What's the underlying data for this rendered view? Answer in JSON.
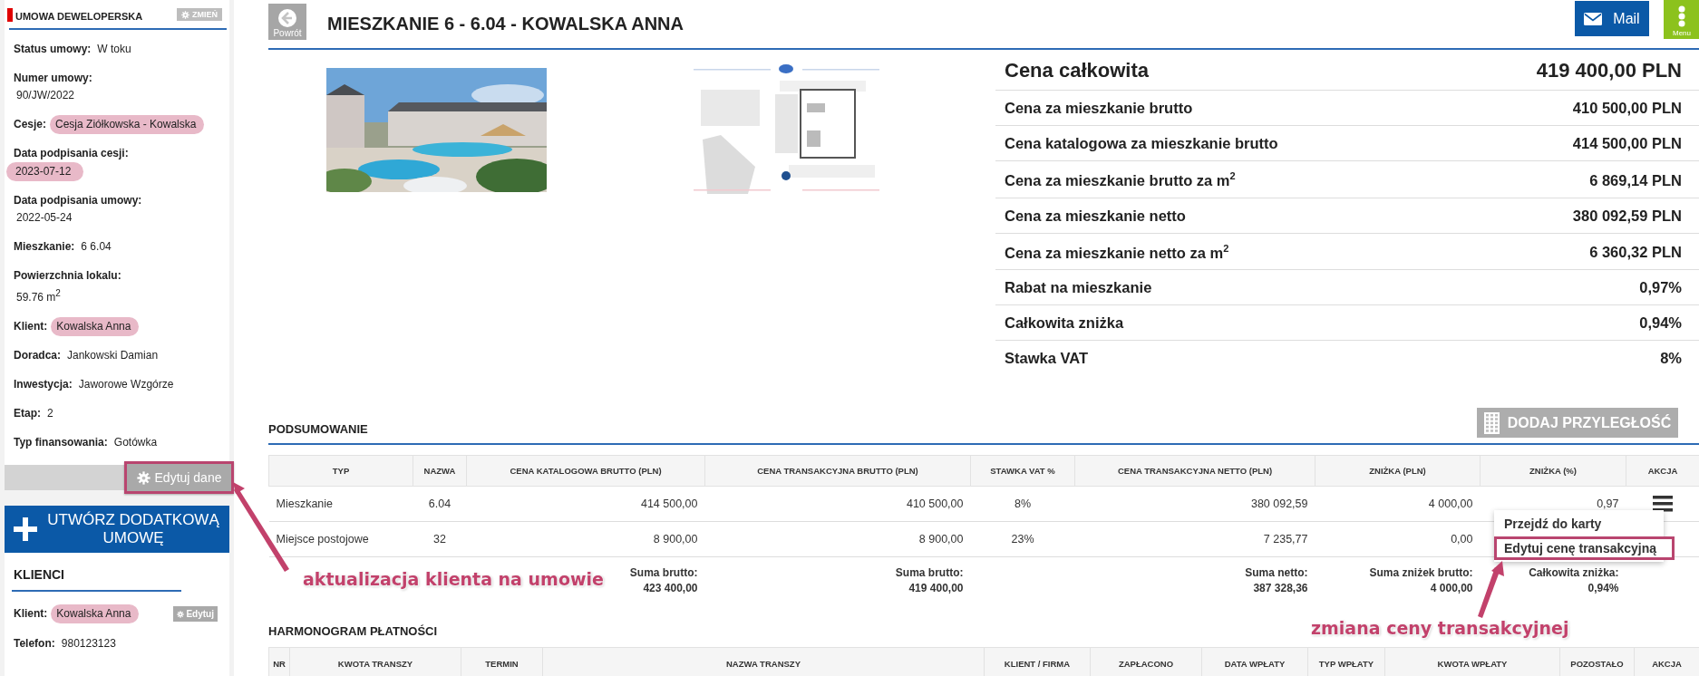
{
  "sidebar": {
    "contract_card": {
      "title": "UMOWA DEWELOPERSKA",
      "change_button": "ZMIEŃ",
      "fields": [
        {
          "label": "Status umowy:",
          "value": "W toku",
          "kind": "inline",
          "highlighted": false
        },
        {
          "label": "Numer umowy:",
          "value": "90/JW/2022",
          "kind": "block",
          "highlighted": false
        },
        {
          "label": "Cesje:",
          "value": "Cesja Ziółkowska - Kowalska",
          "kind": "inline",
          "highlighted": true
        },
        {
          "label": "Data podpisania cesji:",
          "value": "2023-07-12",
          "kind": "block",
          "highlighted": true
        },
        {
          "label": "Data podpisania umowy:",
          "value": "2022-05-24",
          "kind": "block",
          "highlighted": false
        },
        {
          "label": "Mieszkanie:",
          "value": "6 6.04",
          "kind": "inline",
          "highlighted": false
        },
        {
          "label": "Powierzchnia lokalu:",
          "value": "59.76 m$^{2}$",
          "kind": "block",
          "highlighted": false
        },
        {
          "label": "Klient:",
          "value": "Kowalska Anna",
          "kind": "inline",
          "highlighted": true
        },
        {
          "label": "Doradca:",
          "value": "Jankowski Damian",
          "kind": "inline",
          "highlighted": false
        },
        {
          "label": "Inwestycja:",
          "value": "Jaworowe Wzgórze",
          "kind": "inline",
          "highlighted": false
        },
        {
          "label": "Etap:",
          "value": "2",
          "kind": "inline",
          "highlighted": false
        },
        {
          "label": "Typ finansowania:",
          "value": "Gotówka",
          "kind": "inline",
          "highlighted": false
        }
      ],
      "edit_button": {
        "label": "Edytuj dane",
        "highlighted": true
      }
    },
    "create_button": "UTWÓRZ DODATKOWĄ UMOWĘ",
    "clients_card": {
      "title": "KLIENCI",
      "edit_button": "Edytuj",
      "fields": [
        {
          "label": "Klient:",
          "value": "Kowalska Anna",
          "kind": "inline",
          "highlighted": true
        },
        {
          "label": "Telefon:",
          "value": "980123123",
          "kind": "inline",
          "highlighted": false
        }
      ]
    }
  },
  "header": {
    "back_button": "Powrót",
    "title": "MIESZKANIE 6 - 6.04 - KOWALSKA ANNA",
    "mail_button": "Mail",
    "menu_button": "Menu"
  },
  "prices": [
    {
      "label": "Cena całkowita",
      "value": "419 400,00 PLN",
      "kind": "total"
    },
    {
      "label": "Cena za mieszkanie brutto",
      "value": "410 500,00 PLN",
      "kind": "item"
    },
    {
      "label": "Cena katalogowa za mieszkanie brutto",
      "value": "414 500,00 PLN",
      "kind": "item"
    },
    {
      "label": "Cena za mieszkanie brutto za m$^{2}$",
      "value": "6 869,14 PLN",
      "kind": "item"
    },
    {
      "label": "Cena za mieszkanie netto",
      "value": "380 092,59 PLN",
      "kind": "item"
    },
    {
      "label": "Cena za mieszkanie netto za m$^{2}$",
      "value": "6 360,32 PLN",
      "kind": "item"
    },
    {
      "label": "Rabat na mieszkanie",
      "value": "0,97%",
      "kind": "item"
    },
    {
      "label": "Całkowita zniżka",
      "value": "0,94%",
      "kind": "item"
    },
    {
      "label": "Stawka VAT",
      "value": "8%",
      "kind": "item"
    }
  ],
  "summary": {
    "title": "PODSUMOWANIE",
    "add_button": "DODAJ PRZYLEGŁOŚĆ",
    "columns": [
      "TYP",
      "NAZWA",
      "CENA KATALOGOWA BRUTTO (PLN)",
      "CENA TRANSAKCYJNA BRUTTO (PLN)",
      "STAWKA VAT %",
      "CENA TRANSAKCYJNA NETTO (PLN)",
      "ZNIŻKA (PLN)",
      "ZNIŻKA (%)",
      "AKCJA"
    ],
    "rows": [
      {
        "cells": [
          "Mieszkanie",
          "6.04",
          "414 500,00",
          "410 500,00",
          "8%",
          "380 092,59",
          "4 000,00",
          "0,97"
        ],
        "action_menu": true
      },
      {
        "cells": [
          "Miejsce postojowe",
          "32",
          "8 900,00",
          "8 900,00",
          "23%",
          "7 235,77",
          "0,00"
        ],
        "action_menu": false
      }
    ],
    "totals": [
      {
        "kind": "catalog_gross",
        "label": "Suma brutto:",
        "value": "423 400,00"
      },
      {
        "kind": "transaction_gross",
        "label": "Suma brutto:",
        "value": "419 400,00"
      },
      {
        "kind": "transaction_net",
        "label": "Suma netto:",
        "value": "387 328,36"
      },
      {
        "kind": "discount_amount",
        "label": "Suma zniżek brutto:",
        "value": "4 000,00"
      },
      {
        "kind": "discount_percent",
        "label": "Całkowita zniżka:",
        "value": "0,94%"
      }
    ],
    "row_menu": {
      "items": [
        {
          "label": "Przejdź do karty",
          "highlighted": false
        },
        {
          "label": "Edytuj cenę transakcyjną",
          "highlighted": true
        }
      ]
    }
  },
  "schedule": {
    "title": "HARMONOGRAM PŁATNOŚCI",
    "columns": [
      "NR",
      "KWOTA TRANSZY",
      "TERMIN",
      "NAZWA TRANSZY",
      "KLIENT / FIRMA",
      "ZAPŁACONO",
      "DATA WPŁATY",
      "TYP WPŁATY",
      "KWOTA WPŁATY",
      "POZOSTAŁO",
      "AKCJA"
    ]
  },
  "annotations": [
    {
      "text": "aktualizacja klienta na umowie"
    },
    {
      "text": "zmiana ceny transakcyjnej"
    }
  ]
}
